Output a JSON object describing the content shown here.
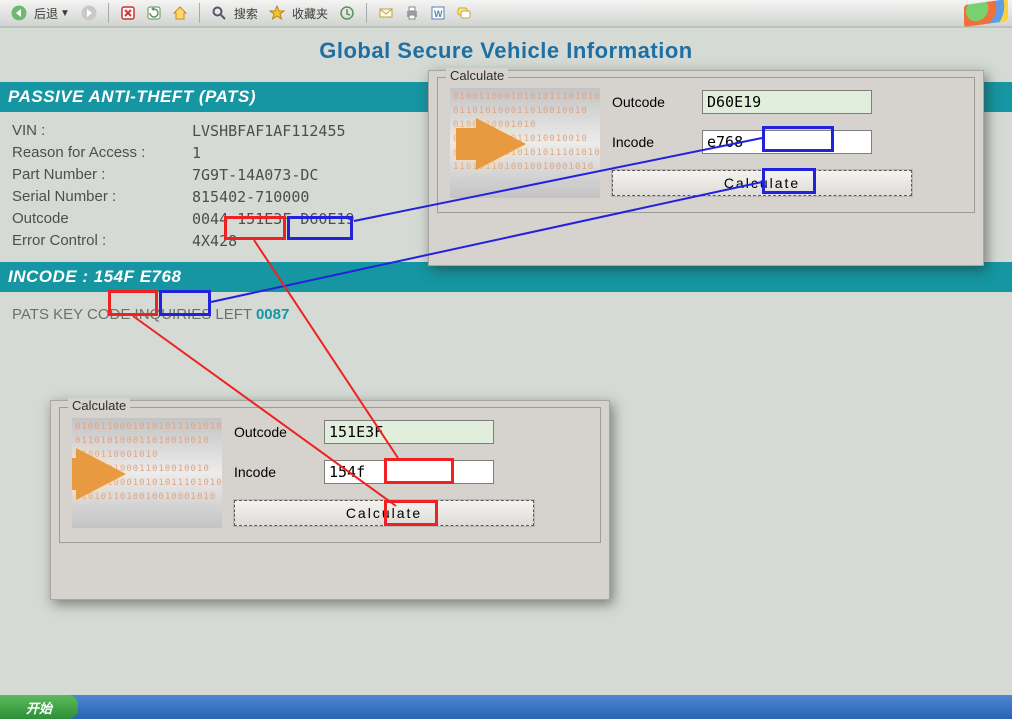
{
  "toolbar": {
    "back_label": "后退",
    "search_label": "搜索",
    "favorites_label": "收藏夹"
  },
  "page": {
    "title": "Global Secure Vehicle Information",
    "section_header": "PASSIVE ANTI-THEFT (PATS)",
    "fields": {
      "vin_label": "VIN :",
      "vin_value": "LVSHBFAF1AF112455",
      "reason_label": "Reason for Access :",
      "reason_value": "1",
      "partnum_label": "Part Number :",
      "partnum_value": "7G9T-14A073-DC",
      "serial_label": "Serial Number :",
      "serial_value": "815402-710000",
      "outcode_label": "Outcode",
      "outcode_prefix": "0044",
      "outcode_mid": "151E3F",
      "outcode_suffix": "D60E19",
      "errctl_label": "Error Control :",
      "errctl_value": "4X428"
    },
    "incode_bar_label": "INCODE :",
    "incode_first": "154F",
    "incode_second": "E768",
    "pats_left_label": "PATS KEY CODE INQUIRIES LEFT",
    "pats_left_value": "0087"
  },
  "calc": {
    "legend": "Calculate",
    "outcode_label": "Outcode",
    "incode_label": "Incode",
    "button_label": "Calculate",
    "bin_lines": "01001100010101011101010000\n011010100011010010010\n0100110001010\n011010100011010010010\n01001100010101011101010000\n1101011010010010001010",
    "top": {
      "outcode_value": "D60E19",
      "incode_value": "e768"
    },
    "bottom": {
      "outcode_value": "151E3F",
      "incode_value": "154f"
    }
  },
  "taskbar": {
    "start_label": "开始"
  }
}
